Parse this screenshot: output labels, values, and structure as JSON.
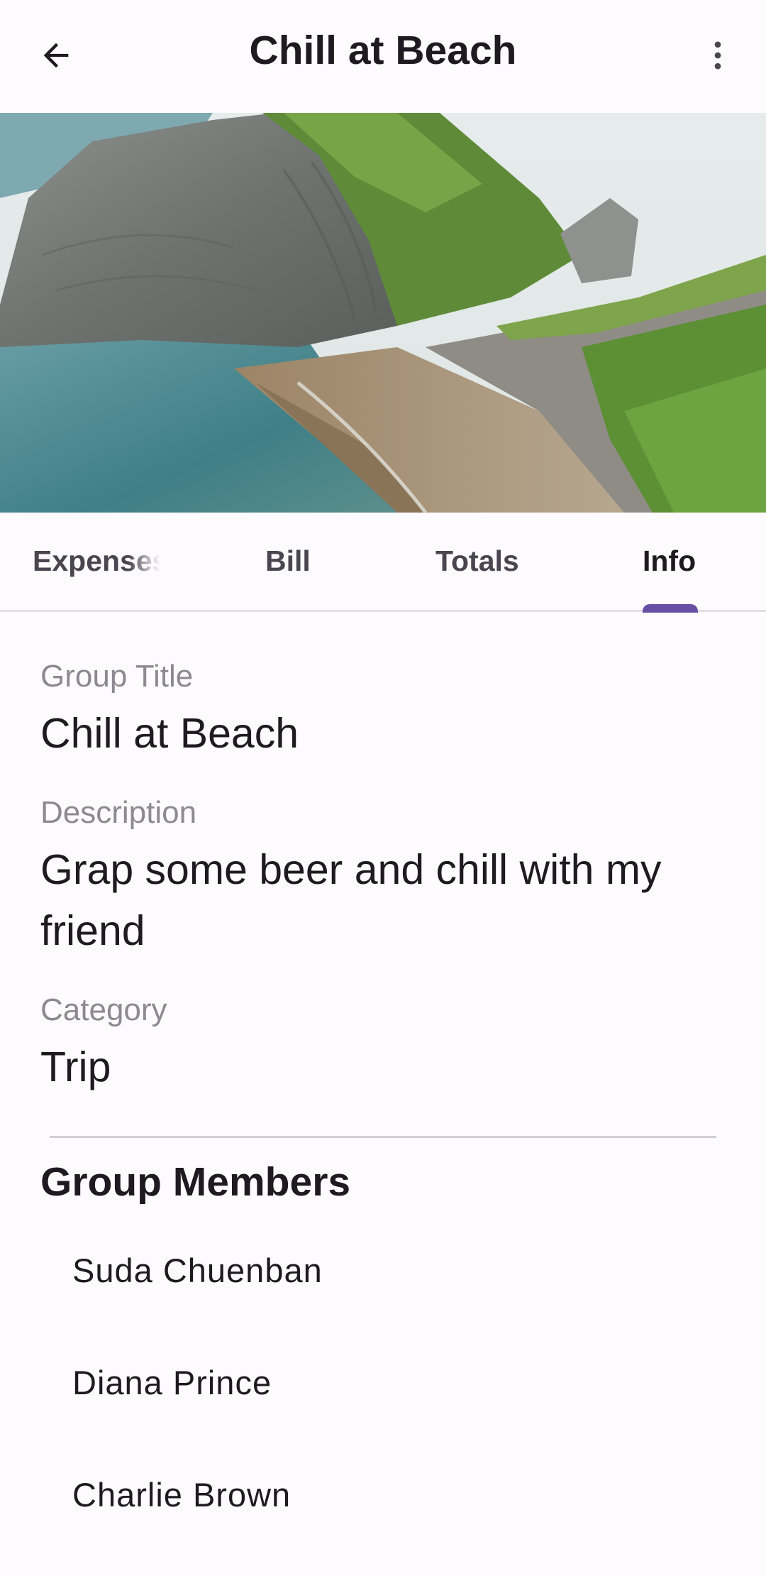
{
  "app_bar": {
    "title": "Chill at Beach",
    "back_icon": "arrow-back-icon",
    "menu_icon": "more-vert-icon"
  },
  "hero": {
    "image": "beach-cliff-photo"
  },
  "tabs": [
    {
      "label": "Expenses",
      "active": false
    },
    {
      "label": "Bill",
      "active": false
    },
    {
      "label": "Totals",
      "active": false
    },
    {
      "label": "Info",
      "active": true
    }
  ],
  "info": {
    "group_title_label": "Group Title",
    "group_title_value": "Chill at Beach",
    "description_label": "Description",
    "description_value": "Grap some beer and chill with my friend",
    "category_label": "Category",
    "category_value": "Trip"
  },
  "members": {
    "heading": "Group Members",
    "items": [
      "Suda Chuenban",
      "Diana Prince",
      "Charlie Brown"
    ]
  },
  "colors": {
    "accent": "#6750a4",
    "background": "#fefbfe",
    "label_gray": "#8c8a90"
  }
}
